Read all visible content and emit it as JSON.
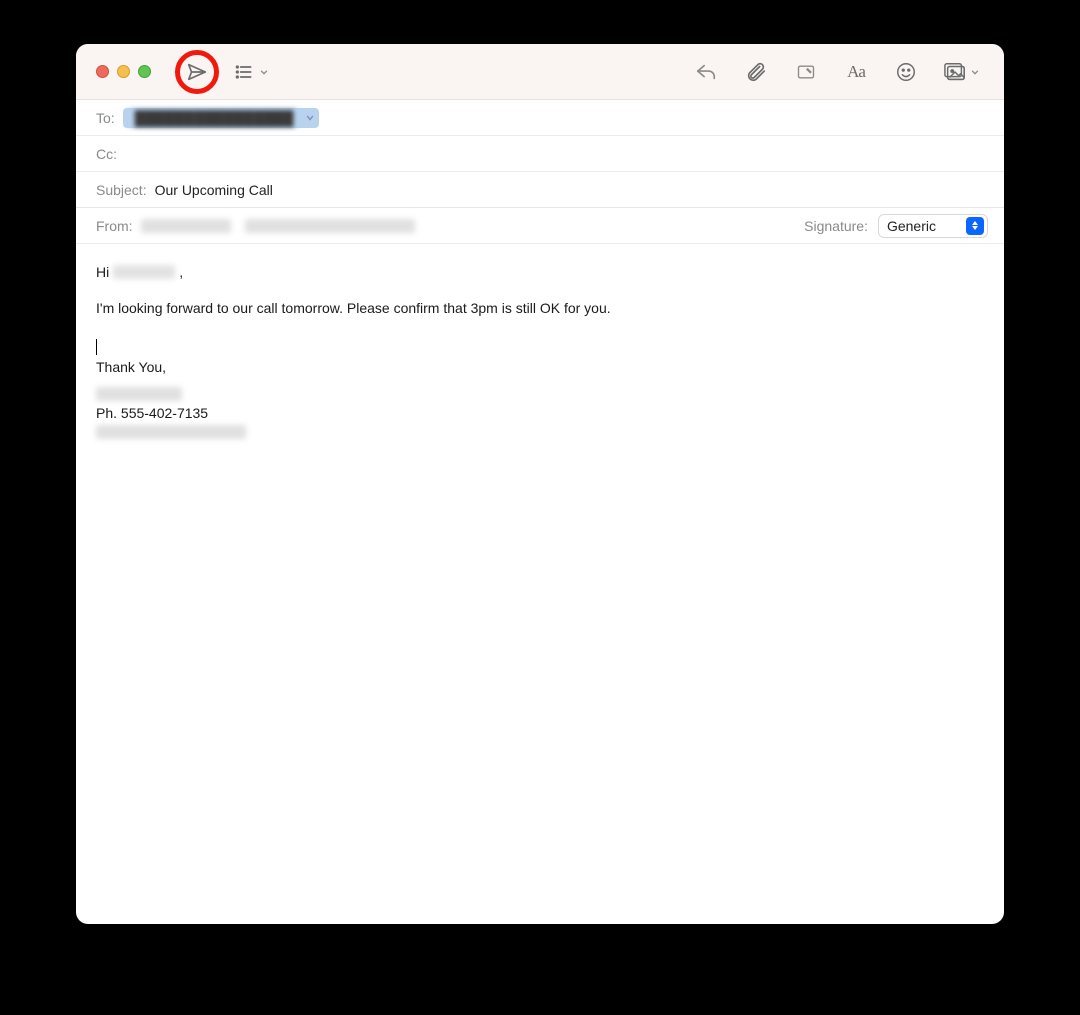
{
  "toolbar": {
    "icons": {
      "send": "send-icon",
      "headers": "header-list-icon",
      "reply": "reply-icon",
      "attach": "paperclip-icon",
      "markup": "markup-icon",
      "format": "text-format-icon",
      "emoji": "emoji-icon",
      "photo": "photo-browser-icon"
    }
  },
  "fields": {
    "to_label": "To:",
    "to_recipient_redacted": "████████████████",
    "cc_label": "Cc:",
    "subject_label": "Subject:",
    "subject_value": "Our Upcoming Call",
    "from_label": "From:",
    "signature_label": "Signature:",
    "signature_value": "Generic"
  },
  "body": {
    "greeting_prefix": "Hi ",
    "greeting_suffix": ",",
    "paragraph": "I'm looking forward to our call tomorrow. Please confirm that 3pm is still OK for you.",
    "closing": "Thank You,",
    "phone": "Ph. 555-402-7135"
  }
}
